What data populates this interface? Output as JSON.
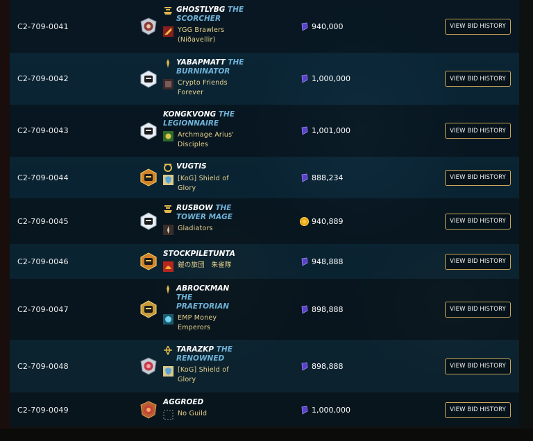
{
  "colors": {
    "accent_gold": "#c9a758",
    "title_blue": "#6fb2d8",
    "guild_text": "#e8d28e"
  },
  "button_label": "VIEW BID HISTORY",
  "rows": [
    {
      "code": "C2-709-0041",
      "player": "GHOSTLYBG",
      "title": "THE SCORCHER",
      "guild": "YGG Brawlers (Niðavellir)",
      "bid": "940,000",
      "currency": "dec-crystal-icon",
      "badge": "gold-league-badge",
      "shade": "dark"
    },
    {
      "code": "C2-709-0042",
      "player": "YABAPMATT",
      "title": "THE BURNINATOR",
      "guild": "Crypto Friends Forever",
      "bid": "1,000,000",
      "currency": "dec-crystal-icon",
      "badge": "diamond-league-badge",
      "shade": "light"
    },
    {
      "code": "C2-709-0043",
      "player": "KONGKVONG",
      "title": "THE LEGIONNAIRE",
      "guild": "Archmage Arius' Disciples",
      "bid": "1,001,000",
      "currency": "dec-crystal-icon",
      "badge": "diamond-league-badge",
      "shade": "dark"
    },
    {
      "code": "C2-709-0044",
      "player": "VUGTIS",
      "title": "",
      "guild": "[KoG] Shield of Glory",
      "bid": "888,234",
      "currency": "dec-crystal-icon",
      "badge": "champion-league-badge",
      "shade": "light"
    },
    {
      "code": "C2-709-0045",
      "player": "RUSBOW",
      "title": "THE TOWER MAGE",
      "guild": "Gladiators",
      "bid": "940,889",
      "currency": "gold-coin-icon",
      "badge": "diamond-league-badge",
      "shade": "dark"
    },
    {
      "code": "C2-709-0046",
      "player": "STOCKPILETUNTA",
      "title": "",
      "guild": "鎧の旅団　朱雀隊",
      "bid": "948,888",
      "currency": "dec-crystal-icon",
      "badge": "champion-league-badge",
      "shade": "light"
    },
    {
      "code": "C2-709-0047",
      "player": "ABROCKMAN",
      "title": "THE PRAETORIAN",
      "guild": "EMP Money Emperors",
      "bid": "898,888",
      "currency": "dec-crystal-icon",
      "badge": "gold-league-badge",
      "shade": "dark"
    },
    {
      "code": "C2-709-0048",
      "player": "TARAZKP",
      "title": "THE RENOWNED",
      "guild": "[KoG] Shield of Glory",
      "bid": "898,888",
      "currency": "dec-crystal-icon",
      "badge": "silver-league-badge",
      "shade": "light"
    },
    {
      "code": "C2-709-0049",
      "player": "AGGROED",
      "title": "",
      "guild": "No Guild",
      "bid": "1,000,000",
      "currency": "dec-crystal-icon",
      "badge": "bronze-league-badge",
      "shade": "dark"
    }
  ]
}
